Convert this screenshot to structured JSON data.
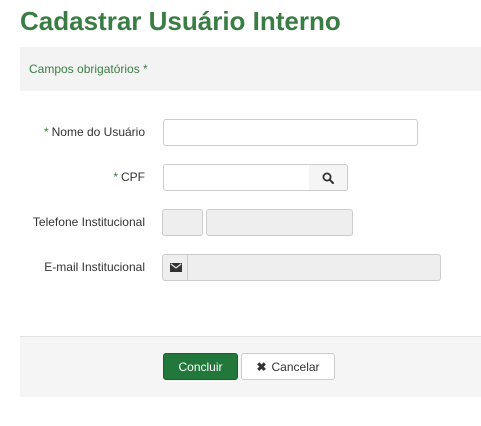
{
  "page": {
    "title": "Cadastrar Usuário Interno",
    "required_note": "Campos obrigatórios *"
  },
  "form": {
    "required_marker": "*",
    "nome": {
      "label": "Nome do Usuário",
      "value": "",
      "placeholder": ""
    },
    "cpf": {
      "label": "CPF",
      "value": "",
      "placeholder": ""
    },
    "telefone": {
      "label": "Telefone Institucional",
      "ddd_value": "",
      "numero_value": ""
    },
    "email": {
      "label": "E-mail Institucional",
      "value": ""
    }
  },
  "actions": {
    "submit_label": "Concluir",
    "cancel_label": "Cancelar",
    "cancel_glyph": "✖"
  },
  "icons": {
    "search": "search-icon",
    "email": "envelope-icon",
    "cancel": "close-icon"
  },
  "colors": {
    "accent": "#3a7d44",
    "primary_button": "#22783a"
  }
}
